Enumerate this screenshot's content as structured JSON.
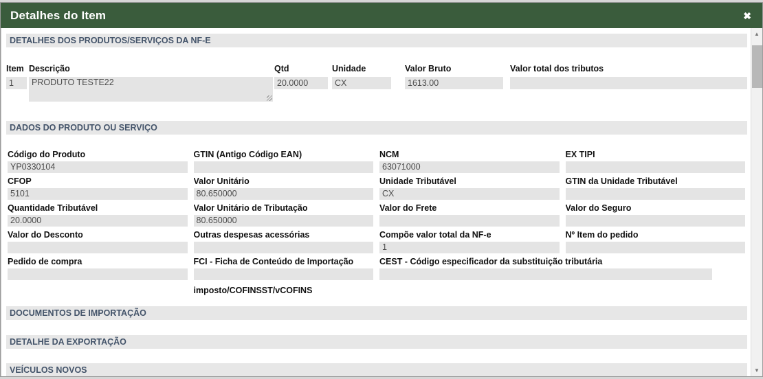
{
  "modal": {
    "title": "Detalhes do Item",
    "close_icon": "✖"
  },
  "section_produtos": "DETALHES DOS PRODUTOS/SERVIÇOS DA NF-E",
  "section_dados": "DADOS DO PRODUTO OU SERVIÇO",
  "section_importacao": "DOCUMENTOS DE IMPORTAÇÃO",
  "section_exportacao": "DETALHE DA EXPORTAÇÃO",
  "section_veiculos": "VEÍCULOS NOVOS",
  "item_table": {
    "col_item": "Item",
    "col_descricao": "Descrição",
    "col_qtd": "Qtd",
    "col_unidade": "Unidade",
    "col_valor_bruto": "Valor Bruto",
    "col_tributos": "Valor total dos tributos",
    "row": {
      "item": "1",
      "descricao": "PRODUTO TESTE22",
      "qtd": "20.0000",
      "unidade": "CX",
      "valor_bruto": "1613.00",
      "tributos": ""
    }
  },
  "dados_fields": [
    {
      "label": "Código do Produto",
      "value": "YP0330104"
    },
    {
      "label": "GTIN (Antigo Código EAN)",
      "value": ""
    },
    {
      "label": "NCM",
      "value": "63071000"
    },
    {
      "label": "EX TIPI",
      "value": ""
    },
    {
      "label": "CFOP",
      "value": "5101"
    },
    {
      "label": "Valor Unitário",
      "value": "80.650000"
    },
    {
      "label": "Unidade Tributável",
      "value": "CX"
    },
    {
      "label": "GTIN da Unidade Tributável",
      "value": ""
    },
    {
      "label": "Quantidade Tributável",
      "value": "20.0000"
    },
    {
      "label": "Valor Unitário de Tributação",
      "value": "80.650000"
    },
    {
      "label": "Valor do Frete",
      "value": ""
    },
    {
      "label": "Valor do Seguro",
      "value": ""
    },
    {
      "label": "Valor do Desconto",
      "value": ""
    },
    {
      "label": "Outras despesas acessórias",
      "value": ""
    },
    {
      "label": "Compõe valor total da NF-e",
      "value": "1"
    },
    {
      "label": "Nº Item do pedido",
      "value": ""
    },
    {
      "label": "Pedido de compra",
      "value": ""
    },
    {
      "label": "FCI - Ficha de Conteúdo de Importação",
      "value": ""
    },
    {
      "label": "CEST - Código especificador da substituição tributária",
      "value": ""
    }
  ],
  "imposto_label": "imposto/COFINSST/vCOFINS",
  "scrollbar": {
    "up_icon": "▲",
    "down_icon": "▼"
  },
  "colors": {
    "titlebar_green": "#3A5C3C",
    "section_text": "#44546A",
    "input_bg": "#E4E4E4"
  }
}
